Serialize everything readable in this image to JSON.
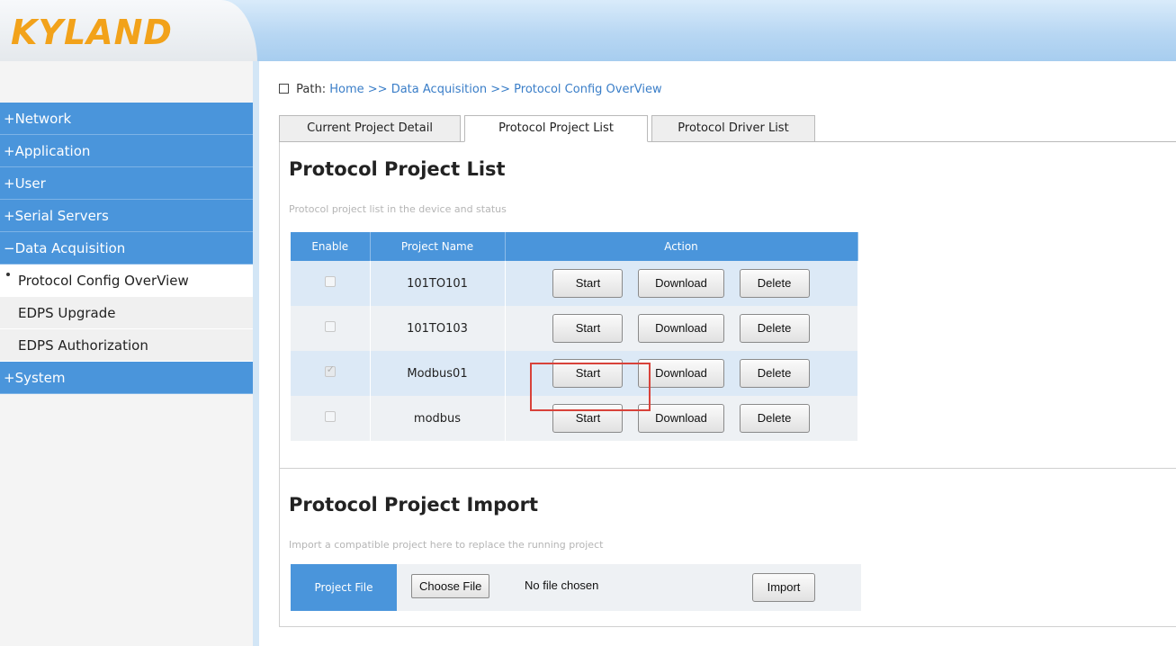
{
  "brand": {
    "logo_text": "KYLAND",
    "accent": "#4a95db",
    "logo_color": "#f2a21a"
  },
  "sidebar": {
    "items": [
      {
        "label": "+Network",
        "type": "main"
      },
      {
        "label": "+Application",
        "type": "main"
      },
      {
        "label": "+User",
        "type": "main"
      },
      {
        "label": "+Serial Servers",
        "type": "main"
      },
      {
        "label": "−Data Acquisition",
        "type": "main",
        "expanded": true
      },
      {
        "label": "Protocol Config OverView",
        "type": "sub",
        "active": true
      },
      {
        "label": "EDPS Upgrade",
        "type": "sub"
      },
      {
        "label": "EDPS Authorization",
        "type": "sub"
      },
      {
        "label": "+System",
        "type": "main"
      }
    ]
  },
  "path": {
    "prefix": "Path:",
    "crumbs": [
      "Home",
      ">>",
      "Data Acquisition",
      ">>",
      "Protocol Config OverView"
    ]
  },
  "tabs": [
    {
      "label": "Current Project Detail",
      "active": false
    },
    {
      "label": "Protocol Project List",
      "active": true
    },
    {
      "label": "Protocol Driver List",
      "active": false
    }
  ],
  "project_list": {
    "title": "Protocol Project List",
    "description": "Protocol project list in the device and status",
    "columns": [
      "Enable",
      "Project Name",
      "Action"
    ],
    "rows": [
      {
        "enabled": false,
        "name": "101TO101",
        "actions": [
          "Start",
          "Download",
          "Delete"
        ]
      },
      {
        "enabled": false,
        "name": "101TO103",
        "actions": [
          "Start",
          "Download",
          "Delete"
        ]
      },
      {
        "enabled": true,
        "name": "Modbus01",
        "actions": [
          "Start",
          "Download",
          "Delete"
        ]
      },
      {
        "enabled": false,
        "name": "modbus",
        "actions": [
          "Start",
          "Download",
          "Delete"
        ]
      }
    ]
  },
  "import": {
    "title": "Protocol Project Import",
    "description": "Import a compatible project here to replace the running project",
    "label": "Project File",
    "choose_label": "Choose File",
    "file_status": "No file chosen",
    "import_label": "Import"
  }
}
